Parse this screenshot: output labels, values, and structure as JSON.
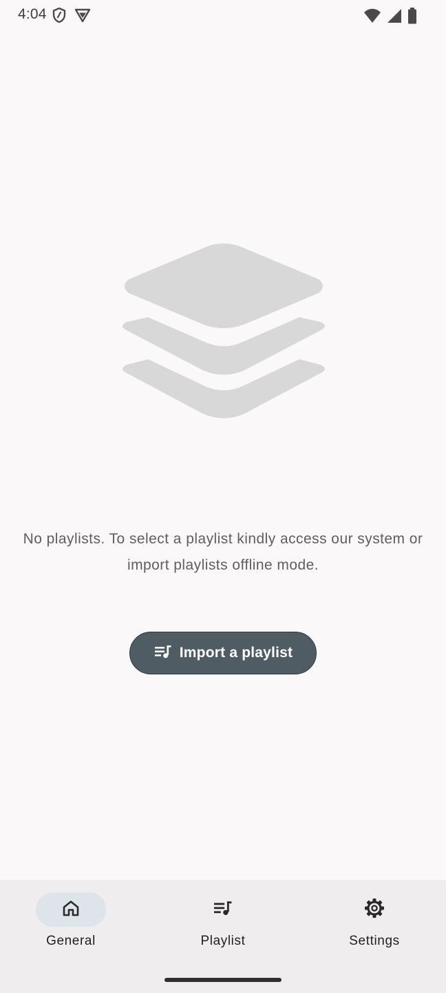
{
  "status_bar": {
    "time": "4:04",
    "left_icons": [
      "shield-icon",
      "vpn-icon"
    ],
    "right_icons": [
      "wifi-icon",
      "signal-icon",
      "battery-icon"
    ]
  },
  "empty_state": {
    "illustration": "layers-icon",
    "message": "No playlists. To select a playlist kindly access our system or import playlists offline mode."
  },
  "import_button": {
    "label": "Import a playlist",
    "icon": "playlist-music-icon"
  },
  "bottom_nav": {
    "items": [
      {
        "label": "General",
        "icon": "home-icon",
        "active": true
      },
      {
        "label": "Playlist",
        "icon": "playlist-music-icon",
        "active": false
      },
      {
        "label": "Settings",
        "icon": "gear-icon",
        "active": false
      }
    ]
  },
  "colors": {
    "background": "#fbf8f9",
    "button": "#4f5c63",
    "nav_background": "#efedee",
    "nav_active_pill": "#dde4ea",
    "illustration": "#d8d8d8"
  }
}
